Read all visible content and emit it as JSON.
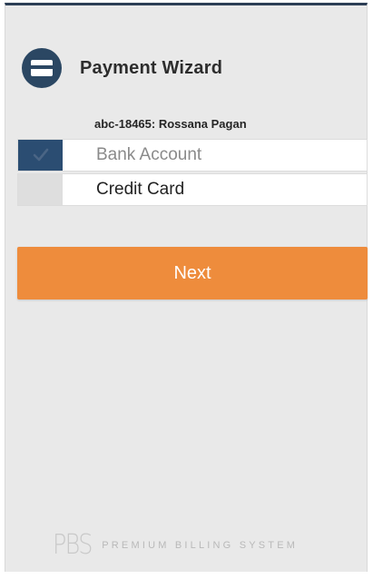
{
  "header": {
    "title": "Payment Wizard",
    "icon": "credit-card-icon"
  },
  "account": {
    "label": "abc-18465: Rossana Pagan"
  },
  "payment_options": [
    {
      "label": "Bank Account",
      "selected": true
    },
    {
      "label": "Credit Card",
      "selected": false
    }
  ],
  "actions": {
    "next_label": "Next"
  },
  "footer": {
    "logo": "PBS",
    "tagline": "PREMIUM BILLING SYSTEM"
  },
  "colors": {
    "accent": "#ee8c3c",
    "primary": "#2b4763",
    "selected_check": "#2b4d72"
  }
}
